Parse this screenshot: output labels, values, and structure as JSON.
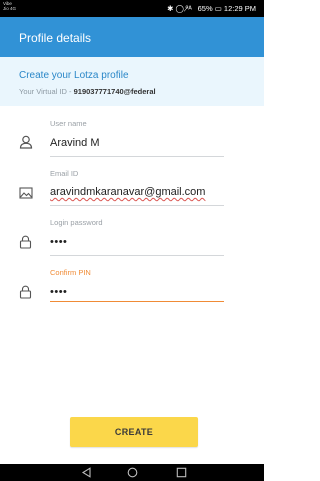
{
  "status_bar": {
    "carrier_top": "Vibe",
    "carrier_bottom": "Jio 4G",
    "right_text": "✱ ◯ ⁰̷ᴬ  65% ▭ 12:29 PM"
  },
  "app_bar": {
    "title": "Profile details"
  },
  "banner": {
    "title": "Create your Lotza profile",
    "virtual_id_prefix": "Your Virtual ID - ",
    "virtual_id": "919037771740@federal"
  },
  "form": {
    "user_name": {
      "label": "User name",
      "value": "Aravind M",
      "icon": "user-icon"
    },
    "email": {
      "label": "Email ID",
      "value": "aravindmkaranavar@gmail.com",
      "icon": "image-icon"
    },
    "login_password": {
      "label": "Login password",
      "value": "••••",
      "icon": "lock-icon"
    },
    "confirm_pin": {
      "label": "Confirm PIN",
      "value": "••••",
      "icon": "lock-icon"
    }
  },
  "create_button": {
    "label": "CREATE"
  },
  "colors": {
    "app_bar": "#3192d6",
    "banner_bg": "#eaf6fd",
    "banner_title": "#2a87c8",
    "active_field": "#f08b36",
    "button": "#fbd74a"
  }
}
